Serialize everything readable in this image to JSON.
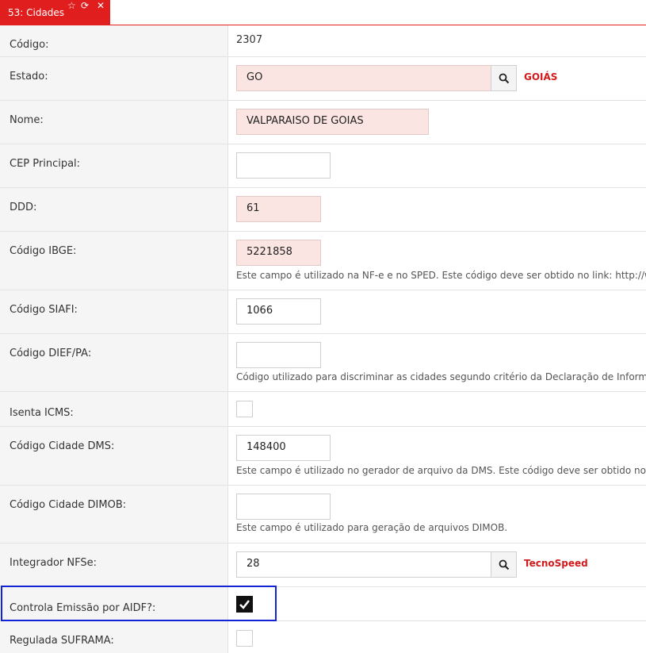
{
  "tab": {
    "title": "53: Cidades"
  },
  "fields": {
    "codigo": {
      "label": "Código:",
      "value": "2307"
    },
    "estado": {
      "label": "Estado:",
      "value": "GO",
      "lookup": "GOIÁS"
    },
    "nome": {
      "label": "Nome:",
      "value": "VALPARAISO DE GOIAS"
    },
    "cep": {
      "label": "CEP Principal:",
      "value": ""
    },
    "ddd": {
      "label": "DDD:",
      "value": "61"
    },
    "ibge": {
      "label": "Código IBGE:",
      "value": "5221858",
      "help": "Este campo é utilizado na NF-e e no SPED. Este código deve ser obtido no link: http://www"
    },
    "siafi": {
      "label": "Código SIAFI:",
      "value": "1066"
    },
    "dief": {
      "label": "Código DIEF/PA:",
      "value": "",
      "help": "Código utilizado para discriminar as cidades segundo critério da Declaração de Informaçõ"
    },
    "isenta": {
      "label": "Isenta ICMS:",
      "checked": false
    },
    "dms": {
      "label": "Código Cidade DMS:",
      "value": "148400",
      "help": "Este campo é utilizado no gerador de arquivo da DMS. Este código deve ser obtido no link"
    },
    "dimob": {
      "label": "Código Cidade DIMOB:",
      "value": "",
      "help": "Este campo é utilizado para geração de arquivos DIMOB."
    },
    "nfse": {
      "label": "Integrador NFSe:",
      "value": "28",
      "lookup": "TecnoSpeed"
    },
    "aidf": {
      "label": "Controla Emissão por AIDF?:",
      "checked": true
    },
    "suframa": {
      "label": "Regulada SUFRAMA:",
      "checked": false
    }
  }
}
